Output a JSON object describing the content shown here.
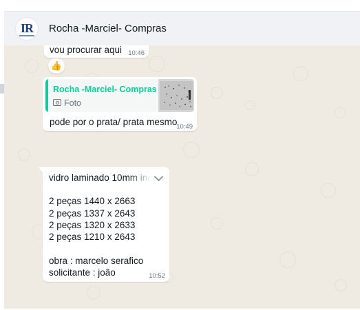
{
  "chat": {
    "contact_name": "Rocha -Marciel- Compras",
    "avatar_logo_text": "IR"
  },
  "messages": [
    {
      "id": "m1",
      "text": "vou procurar aqui",
      "time": "10:46",
      "reaction": "👍"
    },
    {
      "id": "m2",
      "quote_author": "Rocha -Marciel- Compras",
      "quote_media": "Foto",
      "text": "pode por o prata/ prata mesmo",
      "time": "10:49"
    },
    {
      "id": "m3",
      "lines": [
        "vidro laminado 10mm inc",
        "",
        "2 peças 1440 x 2663",
        "2 peças 1337 x 2643",
        "2 peças 1320 x 2633",
        "2 peças 1210 x 2643",
        "",
        "obra : marcelo serafico",
        "solicitante : joão"
      ],
      "time": "10:52"
    }
  ],
  "colors": {
    "quote_accent": "#06cf9c",
    "chat_bg": "#efeae2",
    "header_bg": "#f0f2f5"
  },
  "icons": {
    "reaction": "thumbs-up-icon",
    "media": "camera-icon",
    "menu": "chevron-down-icon"
  }
}
